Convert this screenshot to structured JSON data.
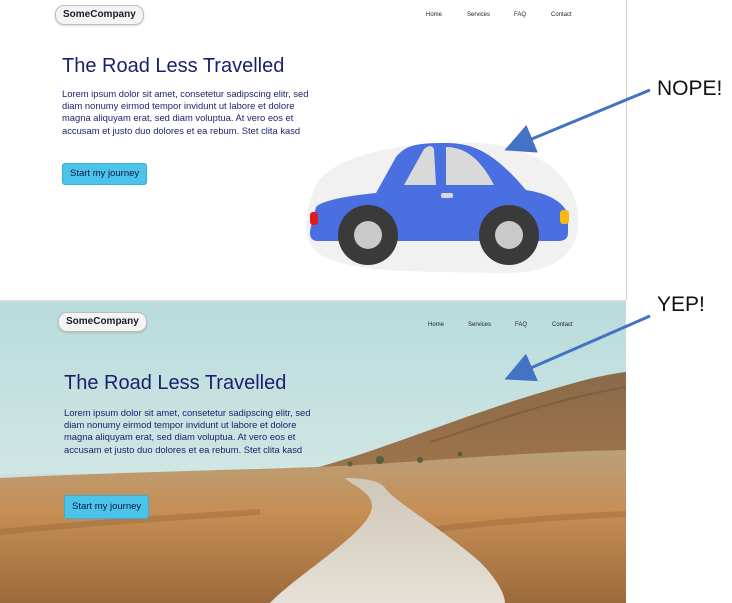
{
  "examples": [
    {
      "logo": "SomeCompany",
      "nav": [
        "Home",
        "Services",
        "FAQ",
        "Contact"
      ],
      "title": "The Road Less Travelled",
      "body": "Lorem ipsum dolor sit amet, consetetur sadipscing elitr, sed diam nonumy eirmod tempor invidunt ut labore et dolore magna aliquyam erat, sed diam voluptua. At vero eos et accusam et justo duo dolores et ea rebum. Stet clita kasd",
      "cta": "Start my journey",
      "illustration_icon": "car-icon",
      "annotation": "NOPE!"
    },
    {
      "logo": "SomeCompany",
      "nav": [
        "Home",
        "Services",
        "FAQ",
        "Contact"
      ],
      "title": "The Road Less Travelled",
      "body": "Lorem ipsum dolor sit amet, consetetur sadipscing elitr, sed diam nonumy eirmod tempor invidunt ut labore et dolore magna aliquyam erat, sed diam voluptua. At vero eos et accusam et justo duo dolores et ea rebum. Stet clita kasd",
      "cta": "Start my journey",
      "background": "road-landscape-photo",
      "annotation": "YEP!"
    }
  ],
  "colors": {
    "title_text": "#1a1f6b",
    "cta_button": "#4cc3ea",
    "arrow": "#4472c4",
    "car_body": "#4a6fe0"
  }
}
